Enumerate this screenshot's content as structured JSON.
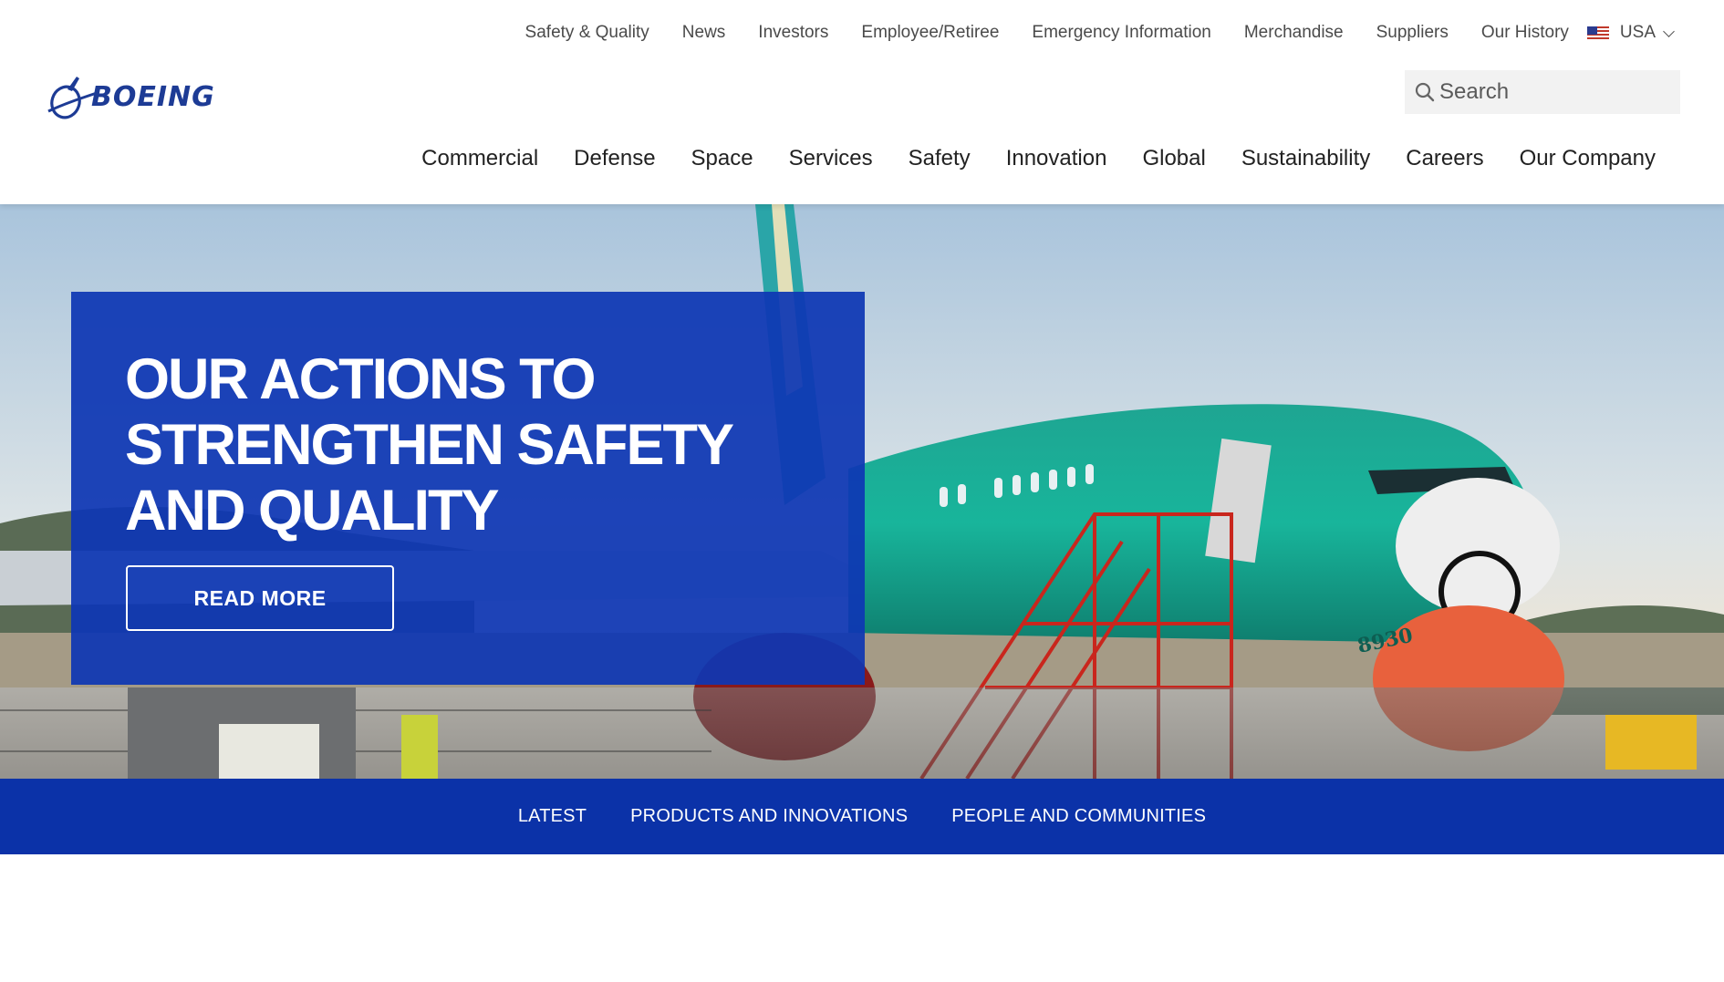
{
  "utility_nav": {
    "items": [
      "Safety & Quality",
      "News",
      "Investors",
      "Employee/Retiree",
      "Emergency Information",
      "Merchandise",
      "Suppliers",
      "Our History"
    ],
    "locale": "USA",
    "locale_icon": "us-flag-icon"
  },
  "brand": {
    "wordmark": "BOEING",
    "logo_icon": "boeing-orbit-logo"
  },
  "search": {
    "placeholder": "Search",
    "value": "",
    "icon": "search-icon"
  },
  "main_nav": {
    "items": [
      "Commercial",
      "Defense",
      "Space",
      "Services",
      "Safety",
      "Innovation",
      "Global",
      "Sustainability",
      "Careers",
      "Our Company"
    ]
  },
  "hero": {
    "headline": "OUR ACTIONS TO STRENGTHEN SAFETY AND QUALITY",
    "cta_label": "READ MORE",
    "image_text": {
      "tail_number": "8930"
    }
  },
  "tabs": {
    "items": [
      "LATEST",
      "PRODUCTS AND INNOVATIONS",
      "PEOPLE AND COMMUNITIES"
    ]
  },
  "colors": {
    "brand_blue": "#0e37b4",
    "tabbar_blue": "#0b32a8",
    "logo_blue": "#1d3b95",
    "search_bg": "#f2f2f2"
  }
}
